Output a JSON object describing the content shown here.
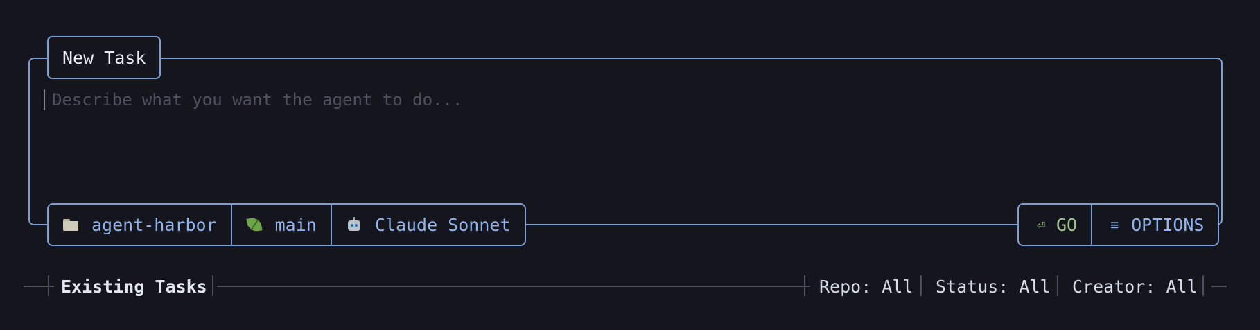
{
  "new_task": {
    "title": "New Task",
    "placeholder": "Describe what you want the agent to do...",
    "repo": {
      "icon": "folder-icon",
      "label": "agent-harbor"
    },
    "branch": {
      "icon": "leaf-icon",
      "label": "main"
    },
    "model": {
      "icon": "robot-icon",
      "label": "Claude Sonnet"
    },
    "go": {
      "glyph": "⏎",
      "label": "GO"
    },
    "options": {
      "glyph": "≡",
      "label": "OPTIONS"
    }
  },
  "existing_tasks": {
    "title": "Existing Tasks",
    "filters": {
      "repo": "Repo: All",
      "status": "Status: All",
      "creator": "Creator: All"
    }
  },
  "colors": {
    "background": "#14151d",
    "accent": "#7d9fd6",
    "go": "#9cc48c"
  }
}
